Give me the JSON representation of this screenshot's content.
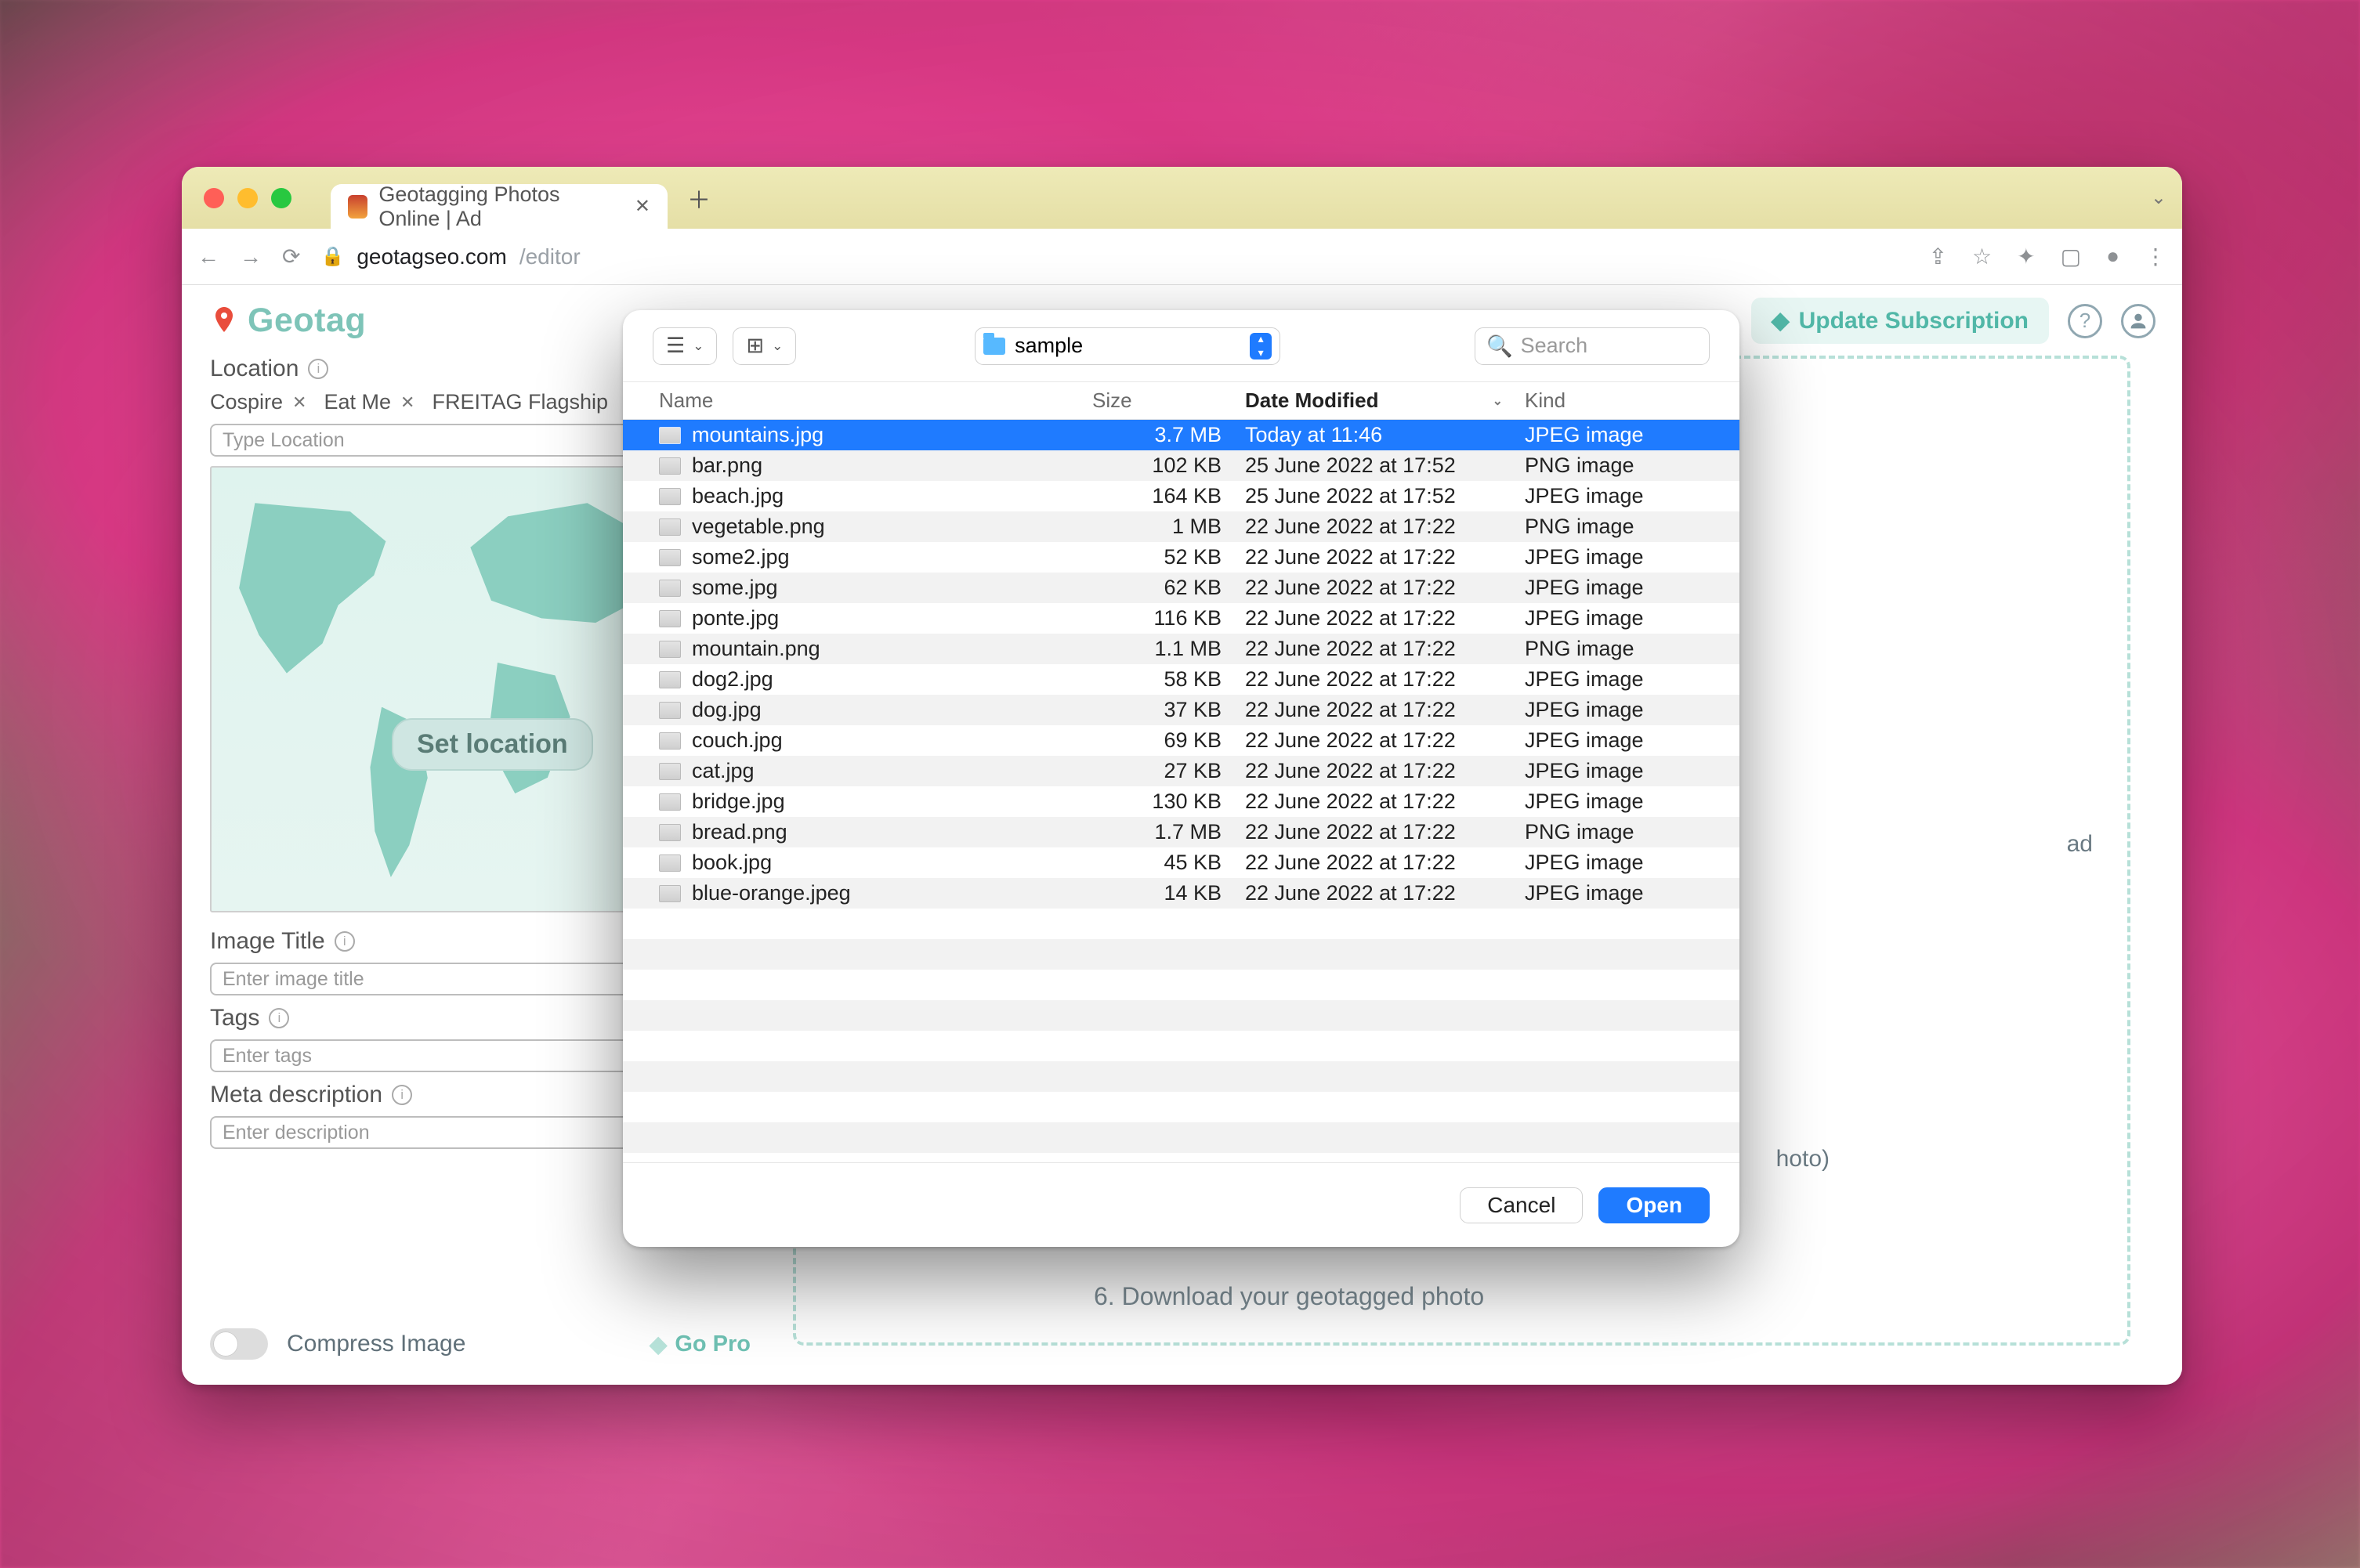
{
  "browser": {
    "tab_title": "Geotagging Photos Online | Ad",
    "url_host": "geotagseo.com",
    "url_path": "/editor"
  },
  "app": {
    "logo_text": "Geotag",
    "update_subscription": "Update Subscription"
  },
  "left_panel": {
    "location_label": "Location",
    "pills": [
      "Cospire",
      "Eat Me",
      "FREITAG Flagship"
    ],
    "location_placeholder": "Type Location",
    "set_location": "Set location",
    "image_title_label": "Image Title",
    "image_title_placeholder": "Enter image title",
    "tags_label": "Tags",
    "tags_placeholder": "Enter tags",
    "meta_label": "Meta description",
    "meta_placeholder": "Enter description",
    "compress_label": "Compress Image",
    "go_pro": "Go Pro"
  },
  "right_panel": {
    "partial_word": "ad",
    "partial_word2": "hoto)",
    "step6": "6. Download your geotagged photo"
  },
  "dialog": {
    "folder": "sample",
    "search_placeholder": "Search",
    "headers": {
      "name": "Name",
      "size": "Size",
      "date": "Date Modified",
      "kind": "Kind"
    },
    "files": [
      {
        "name": "mountains.jpg",
        "size": "3.7 MB",
        "date": "Today at 11:46",
        "kind": "JPEG image",
        "selected": true
      },
      {
        "name": "bar.png",
        "size": "102 KB",
        "date": "25 June 2022 at 17:52",
        "kind": "PNG image"
      },
      {
        "name": "beach.jpg",
        "size": "164 KB",
        "date": "25 June 2022 at 17:52",
        "kind": "JPEG image"
      },
      {
        "name": "vegetable.png",
        "size": "1 MB",
        "date": "22 June 2022 at 17:22",
        "kind": "PNG image"
      },
      {
        "name": "some2.jpg",
        "size": "52 KB",
        "date": "22 June 2022 at 17:22",
        "kind": "JPEG image"
      },
      {
        "name": "some.jpg",
        "size": "62 KB",
        "date": "22 June 2022 at 17:22",
        "kind": "JPEG image"
      },
      {
        "name": "ponte.jpg",
        "size": "116 KB",
        "date": "22 June 2022 at 17:22",
        "kind": "JPEG image"
      },
      {
        "name": "mountain.png",
        "size": "1.1 MB",
        "date": "22 June 2022 at 17:22",
        "kind": "PNG image"
      },
      {
        "name": "dog2.jpg",
        "size": "58 KB",
        "date": "22 June 2022 at 17:22",
        "kind": "JPEG image"
      },
      {
        "name": "dog.jpg",
        "size": "37 KB",
        "date": "22 June 2022 at 17:22",
        "kind": "JPEG image"
      },
      {
        "name": "couch.jpg",
        "size": "69 KB",
        "date": "22 June 2022 at 17:22",
        "kind": "JPEG image"
      },
      {
        "name": "cat.jpg",
        "size": "27 KB",
        "date": "22 June 2022 at 17:22",
        "kind": "JPEG image"
      },
      {
        "name": "bridge.jpg",
        "size": "130 KB",
        "date": "22 June 2022 at 17:22",
        "kind": "JPEG image"
      },
      {
        "name": "bread.png",
        "size": "1.7 MB",
        "date": "22 June 2022 at 17:22",
        "kind": "PNG image"
      },
      {
        "name": "book.jpg",
        "size": "45 KB",
        "date": "22 June 2022 at 17:22",
        "kind": "JPEG image"
      },
      {
        "name": "blue-orange.jpeg",
        "size": "14 KB",
        "date": "22 June 2022 at 17:22",
        "kind": "JPEG image"
      }
    ],
    "cancel": "Cancel",
    "open": "Open"
  }
}
